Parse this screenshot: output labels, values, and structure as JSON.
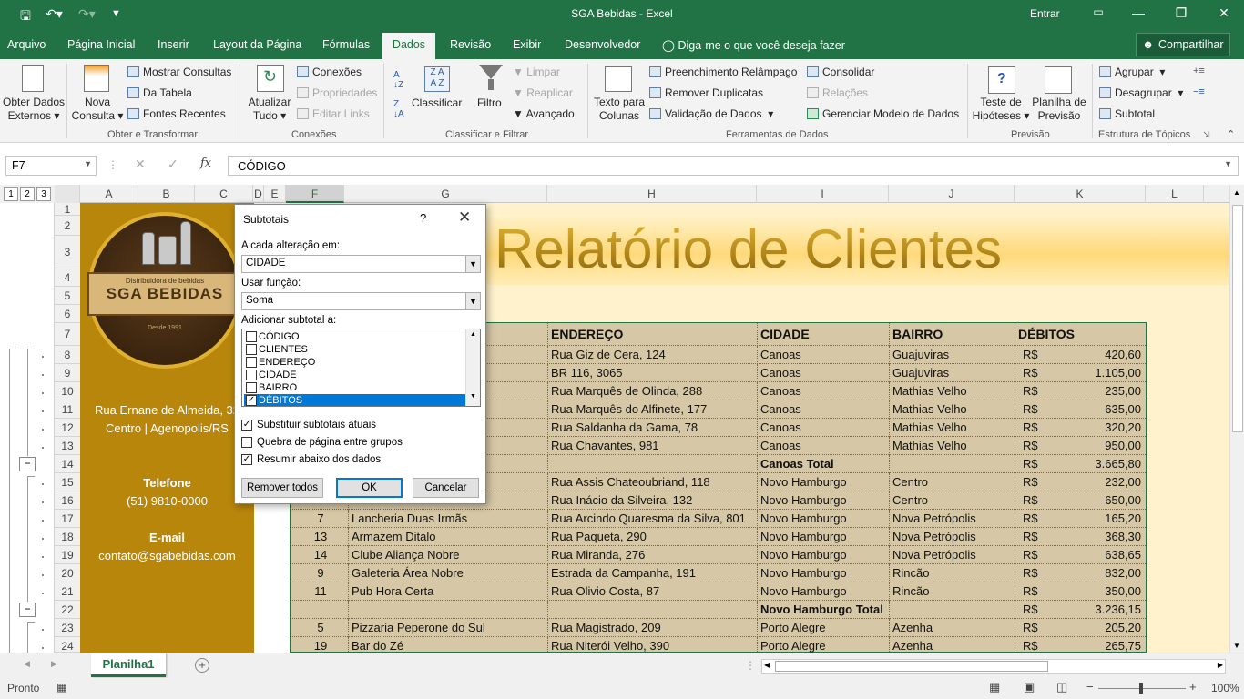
{
  "window": {
    "title": "SGA Bebidas  -  Excel",
    "signin": "Entrar"
  },
  "tabs": [
    "Arquivo",
    "Página Inicial",
    "Inserir",
    "Layout da Página",
    "Fórmulas",
    "Dados",
    "Revisão",
    "Exibir",
    "Desenvolvedor"
  ],
  "tellme": "Diga-me o que você deseja fazer",
  "share": "Compartilhar",
  "ribbon": {
    "obter_dados": [
      "Obter Dados",
      "Externos"
    ],
    "nova_consulta": [
      "Nova",
      "Consulta"
    ],
    "mostrar_consultas": "Mostrar Consultas",
    "da_tabela": "Da Tabela",
    "fontes_recentes": "Fontes Recentes",
    "grp_obter": "Obter e Transformar",
    "atualizar": [
      "Atualizar",
      "Tudo"
    ],
    "conexoes": "Conexões",
    "propriedades": "Propriedades",
    "editar_links": "Editar Links",
    "grp_conexoes": "Conexões",
    "classificar": "Classificar",
    "filtro": "Filtro",
    "limpar": "Limpar",
    "reaplicar": "Reaplicar",
    "avancado": "Avançado",
    "grp_classificar": "Classificar e Filtrar",
    "texto_colunas": [
      "Texto para",
      "Colunas"
    ],
    "preench": "Preenchimento Relâmpago",
    "remover_dup": "Remover Duplicatas",
    "validacao": "Validação de Dados",
    "consolidar": "Consolidar",
    "relacoes": "Relações",
    "gerenciar": "Gerenciar Modelo de Dados",
    "grp_ferramentas": "Ferramentas de Dados",
    "teste_hip": [
      "Teste de",
      "Hipóteses"
    ],
    "planilha_prev": [
      "Planilha de",
      "Previsão"
    ],
    "grp_previsao": "Previsão",
    "agrupar": "Agrupar",
    "desagrupar": "Desagrupar",
    "subtotal": "Subtotal",
    "grp_estrutura": "Estrutura de Tópicos"
  },
  "formula_bar": {
    "namebox": "F7",
    "formula": "CÓDIGO"
  },
  "outline_levels": [
    "1",
    "2",
    "3"
  ],
  "columns": [
    "A",
    "B",
    "C",
    "D",
    "E",
    "F",
    "G",
    "H",
    "I",
    "J",
    "K",
    "L"
  ],
  "rows": [
    "1",
    "2",
    "3",
    "4",
    "5",
    "6",
    "7",
    "8",
    "9",
    "10",
    "11",
    "12",
    "13",
    "14",
    "15",
    "16",
    "17",
    "18",
    "19",
    "20",
    "21",
    "22",
    "23",
    "24"
  ],
  "sheet": {
    "title": "Relatório de Clientes",
    "logo": {
      "sub": "Distribuidora de bebidas",
      "name": "SGA BEBIDAS",
      "since": "Desde 1991"
    },
    "address": [
      "Rua Ernane de Almeida, 32",
      "Centro | Agenopolis/RS"
    ],
    "phone_label": "Telefone",
    "phone": "(51) 9810-0000",
    "email_label": "E-mail",
    "email": "contato@sgabebidas.com",
    "headers": [
      "ENDEREÇO",
      "CIDADE",
      "BAIRRO",
      "DÉBITOS"
    ],
    "currency": "R$",
    "rows": [
      {
        "code": "",
        "client": "a",
        "addr": "Rua Giz de Cera, 124",
        "city": "Canoas",
        "district": "Guajuviras",
        "debt": "420,60"
      },
      {
        "code": "",
        "client": "rra",
        "addr": "BR 116, 3065",
        "city": "Canoas",
        "district": "Guajuviras",
        "debt": "1.105,00"
      },
      {
        "code": "",
        "client": "",
        "addr": "Rua Marquês de Olinda, 288",
        "city": "Canoas",
        "district": "Mathias Velho",
        "debt": "235,00"
      },
      {
        "code": "",
        "client": "",
        "addr": "Rua Marquês do Alfinete, 177",
        "city": "Canoas",
        "district": "Mathias Velho",
        "debt": "635,00"
      },
      {
        "code": "",
        "client": "",
        "addr": "Rua Saldanha da Gama, 78",
        "city": "Canoas",
        "district": "Mathias Velho",
        "debt": "320,20"
      },
      {
        "code": "",
        "client": "Gula",
        "addr": "Rua Chavantes, 981",
        "city": "Canoas",
        "district": "Mathias Velho",
        "debt": "950,00"
      },
      {
        "code": "",
        "client": "",
        "addr": "",
        "city": "Canoas Total",
        "district": "",
        "debt": "3.665,80",
        "total": true
      },
      {
        "code": "",
        "client": "",
        "addr": "Rua Assis Chateoubriand, 118",
        "city": "Novo Hamburgo",
        "district": "Centro",
        "debt": "232,00"
      },
      {
        "code": "",
        "client": "",
        "addr": "Rua Inácio da Silveira, 132",
        "city": "Novo Hamburgo",
        "district": "Centro",
        "debt": "650,00"
      },
      {
        "code": "7",
        "client": "Lancheria Duas Irmãs",
        "addr": "Rua Arcindo Quaresma da Silva, 801",
        "city": "Novo Hamburgo",
        "district": "Nova Petrópolis",
        "debt": "165,20"
      },
      {
        "code": "13",
        "client": "Armazem Ditalo",
        "addr": "Rua Paqueta, 290",
        "city": "Novo Hamburgo",
        "district": "Nova Petrópolis",
        "debt": "368,30"
      },
      {
        "code": "14",
        "client": "Clube Aliança Nobre",
        "addr": "Rua Miranda, 276",
        "city": "Novo Hamburgo",
        "district": "Nova Petrópolis",
        "debt": "638,65"
      },
      {
        "code": "9",
        "client": "Galeteria Área Nobre",
        "addr": "Estrada da Campanha, 191",
        "city": "Novo Hamburgo",
        "district": "Rincão",
        "debt": "832,00"
      },
      {
        "code": "11",
        "client": "Pub Hora Certa",
        "addr": "Rua Olivio Costa, 87",
        "city": "Novo Hamburgo",
        "district": "Rincão",
        "debt": "350,00"
      },
      {
        "code": "",
        "client": "",
        "addr": "",
        "city": "Novo Hamburgo Total",
        "district": "",
        "debt": "3.236,15",
        "total": true
      },
      {
        "code": "5",
        "client": "Pizzaria Peperone do Sul",
        "addr": "Rua Magistrado, 209",
        "city": "Porto Alegre",
        "district": "Azenha",
        "debt": "205,20"
      },
      {
        "code": "19",
        "client": "Bar do Zé",
        "addr": "Rua Niterói Velho, 390",
        "city": "Porto Alegre",
        "district": "Azenha",
        "debt": "265,75"
      }
    ]
  },
  "dialog": {
    "title": "Subtotais",
    "help": "?",
    "label_change": "A cada alteração em:",
    "change_value": "CIDADE",
    "label_func": "Usar função:",
    "func_value": "Soma",
    "label_add": "Adicionar subtotal a:",
    "fields": [
      "CÓDIGO",
      "CLIENTES",
      "ENDEREÇO",
      "CIDADE",
      "BAIRRO",
      "DÉBITOS"
    ],
    "opt_replace": "Substituir subtotais atuais",
    "opt_pagebreak": "Quebra de página entre grupos",
    "opt_summary": "Resumir abaixo dos dados",
    "btn_remove": "Remover todos",
    "btn_ok": "OK",
    "btn_cancel": "Cancelar"
  },
  "sheet_tab": "Planilha1",
  "status": {
    "ready": "Pronto",
    "zoom": "100%"
  }
}
